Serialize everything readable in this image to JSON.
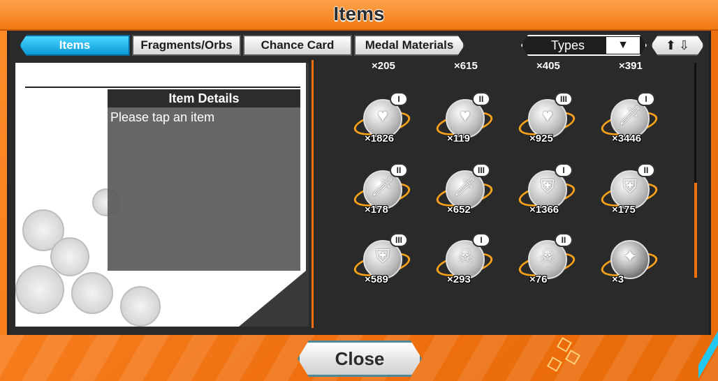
{
  "title": "Items",
  "tabs": [
    {
      "label": "Items",
      "active": true
    },
    {
      "label": "Fragments/Orbs",
      "active": false
    },
    {
      "label": "Chance Card",
      "active": false
    },
    {
      "label": "Medal Materials",
      "active": false
    }
  ],
  "filter": {
    "label": "Types",
    "icon": "dropdown-arrow-icon"
  },
  "sort": {
    "icon": "sort-up-down-icon"
  },
  "details": {
    "header": "Item Details",
    "text": "Please tap an item"
  },
  "top_counts": [
    "×205",
    "×615",
    "×405",
    "×391"
  ],
  "items": [
    {
      "glyph": "heart-icon",
      "tier": "I",
      "qty": "×1826"
    },
    {
      "glyph": "heart-icon",
      "tier": "II",
      "qty": "×119"
    },
    {
      "glyph": "heart-icon",
      "tier": "III",
      "qty": "×925"
    },
    {
      "glyph": "sword-icon",
      "tier": "I",
      "qty": "×3446"
    },
    {
      "glyph": "sword-icon",
      "tier": "II",
      "qty": "×178"
    },
    {
      "glyph": "sword-icon",
      "tier": "III",
      "qty": "×652"
    },
    {
      "glyph": "armor-icon",
      "tier": "I",
      "qty": "×1366"
    },
    {
      "glyph": "armor-icon",
      "tier": "II",
      "qty": "×175"
    },
    {
      "glyph": "armor-icon",
      "tier": "III",
      "qty": "×589"
    },
    {
      "glyph": "skull-icon",
      "tier": "I",
      "qty": "×293"
    },
    {
      "glyph": "skull-icon",
      "tier": "II",
      "qty": "×76"
    },
    {
      "glyph": "sparkle-icon",
      "tier": "",
      "qty": "×3"
    }
  ],
  "close_label": "Close",
  "colors": {
    "accent": "#f07010",
    "tab_active": "#0a98d8",
    "panel": "#2a2a2a"
  }
}
